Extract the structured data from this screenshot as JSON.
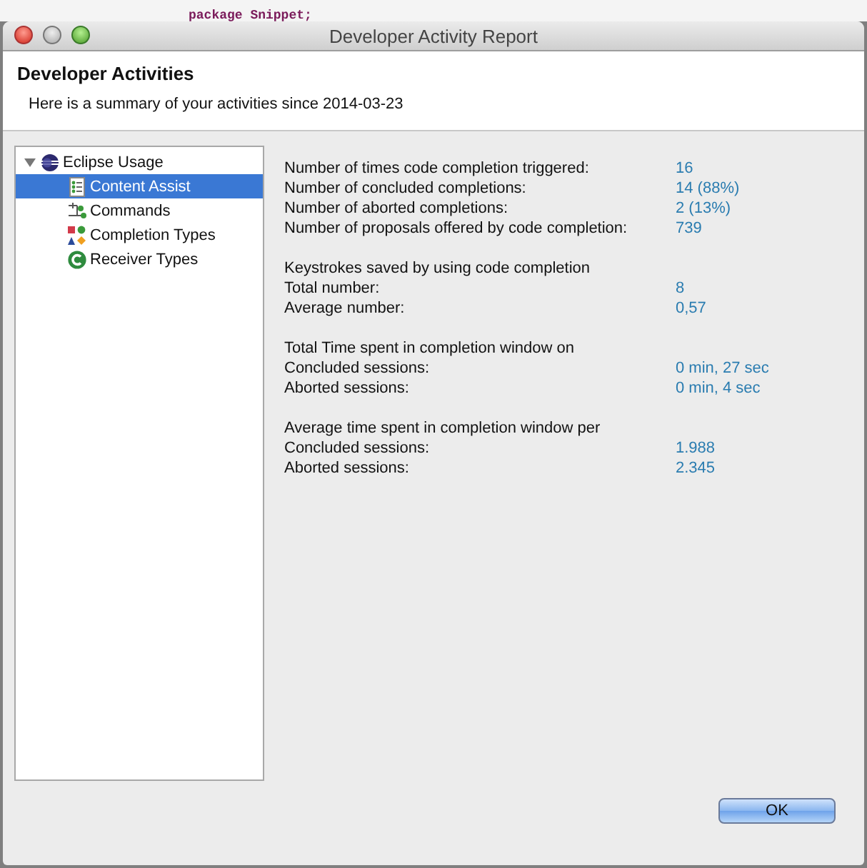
{
  "background_code": "package Snippet;",
  "window": {
    "title": "Developer Activity Report"
  },
  "header": {
    "title": "Developer Activities",
    "subtitle": "Here is a summary of your activities since 2014-03-23"
  },
  "tree": {
    "label": "Eclipse Usage",
    "expanded": true,
    "selected": false,
    "children": [
      {
        "label": "Content Assist",
        "kind": "list",
        "selected": true
      },
      {
        "label": "Commands",
        "kind": "commands",
        "selected": false
      },
      {
        "label": "Completion Types",
        "kind": "types",
        "selected": false
      },
      {
        "label": "Receiver Types",
        "kind": "receiver",
        "selected": false
      }
    ]
  },
  "sections": [
    {
      "rows": [
        {
          "label": "Number of times code completion triggered:",
          "value": "16"
        },
        {
          "label": "Number of concluded completions:",
          "value": "14 (88%)"
        },
        {
          "label": "Number of aborted completions:",
          "value": "2 (13%)"
        },
        {
          "label": "Number of proposals offered by code completion:",
          "value": "739"
        }
      ]
    },
    {
      "heading": "Keystrokes saved by using code completion",
      "rows": [
        {
          "label": "Total number:",
          "value": "8"
        },
        {
          "label": "Average number:",
          "value": "0,57"
        }
      ]
    },
    {
      "heading": "Total Time spent in completion window on",
      "rows": [
        {
          "label": "Concluded sessions:",
          "value": "0 min, 27 sec"
        },
        {
          "label": "Aborted sessions:",
          "value": "0 min, 4 sec"
        }
      ]
    },
    {
      "heading": "Average time spent in completion window per",
      "rows": [
        {
          "label": "Concluded sessions:",
          "value": "1.988"
        },
        {
          "label": "Aborted sessions:",
          "value": "2.345"
        }
      ]
    }
  ],
  "buttons": [
    {
      "label": "OK",
      "default": true
    }
  ]
}
